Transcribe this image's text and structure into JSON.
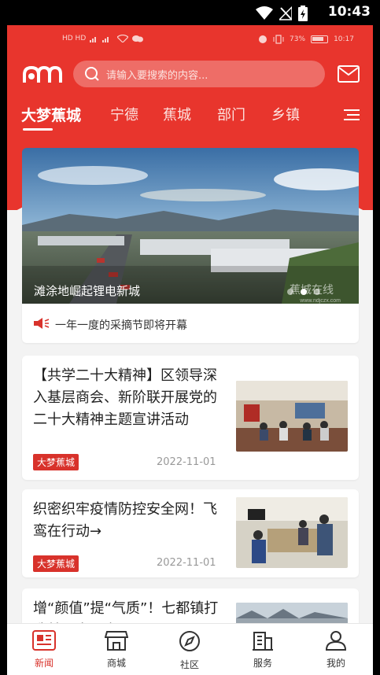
{
  "system": {
    "time": "10:43"
  },
  "inner_status": {
    "left_text": "HD HD",
    "battery": "73%",
    "time": "10:17"
  },
  "search": {
    "placeholder": "请输入要搜索的内容..."
  },
  "tabs": [
    {
      "label": "大梦蕉城",
      "active": true
    },
    {
      "label": "宁德",
      "active": false
    },
    {
      "label": "蕉城",
      "active": false
    },
    {
      "label": "部门",
      "active": false
    },
    {
      "label": "乡镇",
      "active": false
    }
  ],
  "banner": {
    "caption": "滩涂地崛起锂电新城",
    "watermark": "蕉城在线",
    "watermark_url": "www.ndjczx.com",
    "slide_count": 3,
    "active_slide": 2
  },
  "notice": {
    "text": "一年一度的采摘节即将开幕"
  },
  "news": [
    {
      "title": "【共学二十大精神】区领导深入基层商会、新阶联开展党的二十大精神主题宣讲活动",
      "tag": "大梦蕉城",
      "date": "2022-11-01"
    },
    {
      "title": "织密织牢疫情防控安全网！飞鸾在行动→",
      "tag": "大梦蕉城",
      "date": "2022-11-01"
    },
    {
      "title": "增“颜值”提“气质”！七都镇打造美丽宜居家园",
      "tag": "",
      "date": ""
    }
  ],
  "bottom_nav": [
    {
      "label": "新闻",
      "icon": "news-icon",
      "active": true
    },
    {
      "label": "商城",
      "icon": "shop-icon",
      "active": false
    },
    {
      "label": "社区",
      "icon": "compass-icon",
      "active": false
    },
    {
      "label": "服务",
      "icon": "building-icon",
      "active": false
    },
    {
      "label": "我的",
      "icon": "user-icon",
      "active": false
    }
  ],
  "colors": {
    "brand_red": "#e8352d",
    "tag_red": "#d8322b",
    "background": "#f3f3f3"
  }
}
